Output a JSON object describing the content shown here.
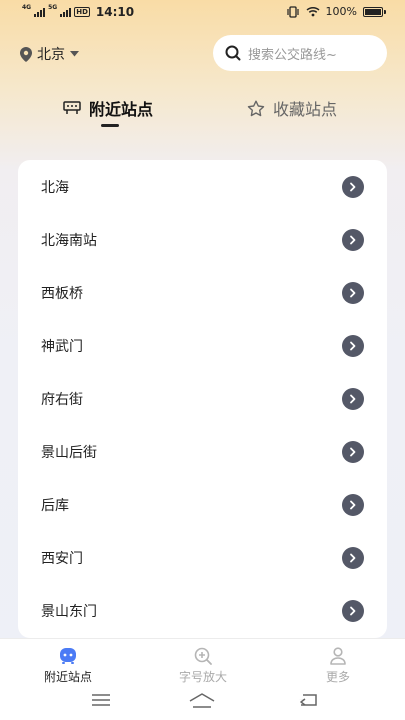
{
  "status_bar": {
    "network_1": "4G",
    "network_2": "5G",
    "hd": "HD",
    "time": "14:10",
    "battery": "100%"
  },
  "header": {
    "city": "北京",
    "search_placeholder": "搜索公交路线~"
  },
  "tabs": [
    {
      "label": "附近站点",
      "active": true
    },
    {
      "label": "收藏站点",
      "active": false
    }
  ],
  "stations": [
    {
      "name": "北海"
    },
    {
      "name": "北海南站"
    },
    {
      "name": "西板桥"
    },
    {
      "name": "神武门"
    },
    {
      "name": "府右街"
    },
    {
      "name": "景山后街"
    },
    {
      "name": "后库"
    },
    {
      "name": "西安门"
    },
    {
      "name": "景山东门"
    }
  ],
  "bottom_nav": [
    {
      "label": "附近站点",
      "icon": "bus-face-icon",
      "active": true
    },
    {
      "label": "字号放大",
      "icon": "zoom-text-icon",
      "active": false
    },
    {
      "label": "更多",
      "icon": "person-icon",
      "active": false
    }
  ],
  "colors": {
    "accent": "#4b7bf5",
    "arrow_bg": "#545867"
  }
}
